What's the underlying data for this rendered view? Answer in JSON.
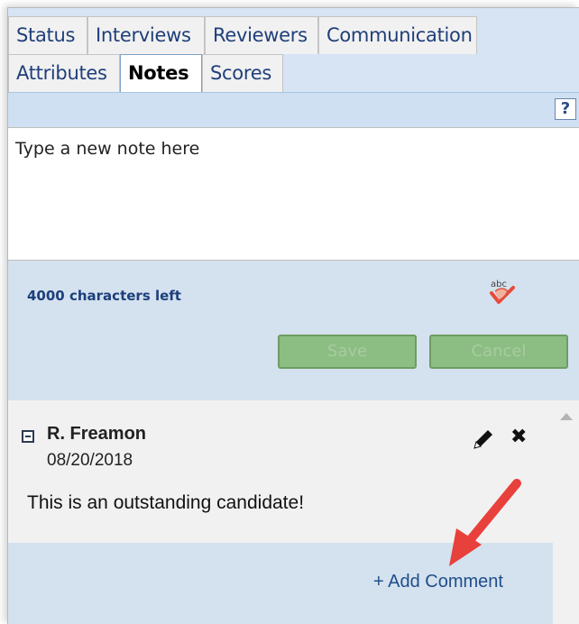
{
  "tabs": {
    "row1": [
      {
        "label": "Status"
      },
      {
        "label": "Interviews"
      },
      {
        "label": "Reviewers"
      },
      {
        "label": "Communication"
      }
    ],
    "row2": [
      {
        "label": "Attributes"
      },
      {
        "label": "Notes",
        "active": true
      },
      {
        "label": "Scores"
      }
    ]
  },
  "help": {
    "label": "?"
  },
  "editor": {
    "placeholder": "Type a new note here",
    "chars_left": "4000 characters left",
    "spellcheck_icon": "spellcheck-icon",
    "save_label": "Save",
    "cancel_label": "Cancel"
  },
  "notes": [
    {
      "author": "R. Freamon",
      "date": "08/20/2018",
      "text": "This is an outstanding candidate!",
      "add_comment_label": "+ Add Comment"
    }
  ],
  "colors": {
    "tab_strip_bg": "#d6e4f4",
    "controls_bg": "#d4e1ee",
    "button_green": "#8cbd83",
    "link_blue": "#1f4e8c",
    "callout_red": "#e8403b"
  }
}
